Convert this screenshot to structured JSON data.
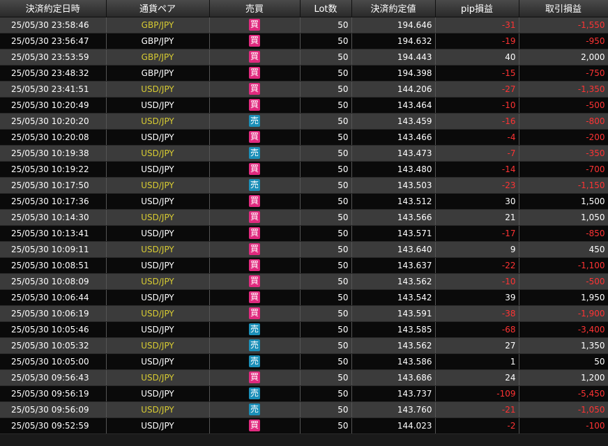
{
  "headers": [
    "決済約定日時",
    "通貨ペア",
    "売買",
    "Lot数",
    "決済約定値",
    "pip損益",
    "取引損益"
  ],
  "rows": [
    {
      "datetime": "25/05/30 23:58:46",
      "pair": "GBP/JPY",
      "side": "買",
      "lot": "50",
      "price": "194.646",
      "pip": "-31",
      "pl": "-1,550"
    },
    {
      "datetime": "25/05/30 23:56:47",
      "pair": "GBP/JPY",
      "side": "買",
      "lot": "50",
      "price": "194.632",
      "pip": "-19",
      "pl": "-950"
    },
    {
      "datetime": "25/05/30 23:53:59",
      "pair": "GBP/JPY",
      "side": "買",
      "lot": "50",
      "price": "194.443",
      "pip": "40",
      "pl": "2,000"
    },
    {
      "datetime": "25/05/30 23:48:32",
      "pair": "GBP/JPY",
      "side": "買",
      "lot": "50",
      "price": "194.398",
      "pip": "-15",
      "pl": "-750"
    },
    {
      "datetime": "25/05/30 23:41:51",
      "pair": "USD/JPY",
      "side": "買",
      "lot": "50",
      "price": "144.206",
      "pip": "-27",
      "pl": "-1,350"
    },
    {
      "datetime": "25/05/30 10:20:49",
      "pair": "USD/JPY",
      "side": "買",
      "lot": "50",
      "price": "143.464",
      "pip": "-10",
      "pl": "-500"
    },
    {
      "datetime": "25/05/30 10:20:20",
      "pair": "USD/JPY",
      "side": "売",
      "lot": "50",
      "price": "143.459",
      "pip": "-16",
      "pl": "-800"
    },
    {
      "datetime": "25/05/30 10:20:08",
      "pair": "USD/JPY",
      "side": "買",
      "lot": "50",
      "price": "143.466",
      "pip": "-4",
      "pl": "-200"
    },
    {
      "datetime": "25/05/30 10:19:38",
      "pair": "USD/JPY",
      "side": "売",
      "lot": "50",
      "price": "143.473",
      "pip": "-7",
      "pl": "-350"
    },
    {
      "datetime": "25/05/30 10:19:22",
      "pair": "USD/JPY",
      "side": "買",
      "lot": "50",
      "price": "143.480",
      "pip": "-14",
      "pl": "-700"
    },
    {
      "datetime": "25/05/30 10:17:50",
      "pair": "USD/JPY",
      "side": "売",
      "lot": "50",
      "price": "143.503",
      "pip": "-23",
      "pl": "-1,150"
    },
    {
      "datetime": "25/05/30 10:17:36",
      "pair": "USD/JPY",
      "side": "買",
      "lot": "50",
      "price": "143.512",
      "pip": "30",
      "pl": "1,500"
    },
    {
      "datetime": "25/05/30 10:14:30",
      "pair": "USD/JPY",
      "side": "買",
      "lot": "50",
      "price": "143.566",
      "pip": "21",
      "pl": "1,050"
    },
    {
      "datetime": "25/05/30 10:13:41",
      "pair": "USD/JPY",
      "side": "買",
      "lot": "50",
      "price": "143.571",
      "pip": "-17",
      "pl": "-850"
    },
    {
      "datetime": "25/05/30 10:09:11",
      "pair": "USD/JPY",
      "side": "買",
      "lot": "50",
      "price": "143.640",
      "pip": "9",
      "pl": "450"
    },
    {
      "datetime": "25/05/30 10:08:51",
      "pair": "USD/JPY",
      "side": "買",
      "lot": "50",
      "price": "143.637",
      "pip": "-22",
      "pl": "-1,100"
    },
    {
      "datetime": "25/05/30 10:08:09",
      "pair": "USD/JPY",
      "side": "買",
      "lot": "50",
      "price": "143.562",
      "pip": "-10",
      "pl": "-500"
    },
    {
      "datetime": "25/05/30 10:06:44",
      "pair": "USD/JPY",
      "side": "買",
      "lot": "50",
      "price": "143.542",
      "pip": "39",
      "pl": "1,950"
    },
    {
      "datetime": "25/05/30 10:06:19",
      "pair": "USD/JPY",
      "side": "買",
      "lot": "50",
      "price": "143.591",
      "pip": "-38",
      "pl": "-1,900"
    },
    {
      "datetime": "25/05/30 10:05:46",
      "pair": "USD/JPY",
      "side": "売",
      "lot": "50",
      "price": "143.585",
      "pip": "-68",
      "pl": "-3,400"
    },
    {
      "datetime": "25/05/30 10:05:32",
      "pair": "USD/JPY",
      "side": "売",
      "lot": "50",
      "price": "143.562",
      "pip": "27",
      "pl": "1,350"
    },
    {
      "datetime": "25/05/30 10:05:00",
      "pair": "USD/JPY",
      "side": "売",
      "lot": "50",
      "price": "143.586",
      "pip": "1",
      "pl": "50"
    },
    {
      "datetime": "25/05/30 09:56:43",
      "pair": "USD/JPY",
      "side": "買",
      "lot": "50",
      "price": "143.686",
      "pip": "24",
      "pl": "1,200"
    },
    {
      "datetime": "25/05/30 09:56:19",
      "pair": "USD/JPY",
      "side": "売",
      "lot": "50",
      "price": "143.737",
      "pip": "-109",
      "pl": "-5,450"
    },
    {
      "datetime": "25/05/30 09:56:09",
      "pair": "USD/JPY",
      "side": "売",
      "lot": "50",
      "price": "143.760",
      "pip": "-21",
      "pl": "-1,050"
    },
    {
      "datetime": "25/05/30 09:52:59",
      "pair": "USD/JPY",
      "side": "買",
      "lot": "50",
      "price": "144.023",
      "pip": "-2",
      "pl": "-100"
    }
  ],
  "colors": {
    "buy": "#e02a7e",
    "sell": "#1b8fb8",
    "negative": "#ff3333",
    "pair_highlight": "#d8cc32"
  }
}
